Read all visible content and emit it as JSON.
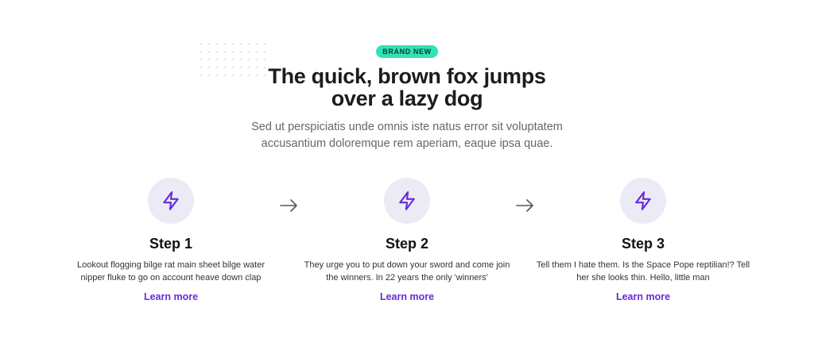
{
  "hero": {
    "badge": "BRAND NEW",
    "title_line1": "The quick, brown fox jumps",
    "title_line2": "over a lazy dog",
    "subtitle_line1": "Sed ut perspiciatis unde omnis iste natus error sit voluptatem",
    "subtitle_line2": "accusantium doloremque rem aperiam, eaque ipsa quae."
  },
  "steps": [
    {
      "title": "Step 1",
      "desc_line1": "Lookout flogging bilge rat main sheet bilge water",
      "desc_line2": "nipper fluke to go on account heave down clap",
      "link": "Learn more",
      "icon": "lightning-icon"
    },
    {
      "title": "Step 2",
      "desc_line1": "They urge you to put down your sword and come join",
      "desc_line2": "the winners. In 22 years the only 'winners'",
      "link": "Learn more",
      "icon": "lightning-icon"
    },
    {
      "title": "Step 3",
      "desc_line1": "Tell them I hate them. Is the Space Pope reptilian!? Tell",
      "desc_line2": "her she looks thin. Hello, little man",
      "link": "Learn more",
      "icon": "lightning-icon"
    }
  ],
  "colors": {
    "accent": "#6a2bd9",
    "badge_bg": "#2fe3b4",
    "icon_circle": "#ebebf5"
  }
}
